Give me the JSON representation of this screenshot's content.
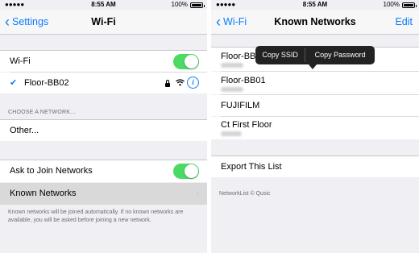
{
  "status_bar": {
    "time": "8:55 AM",
    "battery": "100%"
  },
  "left": {
    "nav": {
      "back_label": "Settings",
      "title": "Wi-Fi"
    },
    "wifi_row": {
      "label": "Wi-Fi",
      "on": true
    },
    "connected_network": {
      "name": "Floor-BB02"
    },
    "choose_header": "CHOOSE A NETWORK...",
    "other_label": "Other...",
    "ask_to_join": {
      "label": "Ask to Join Networks",
      "on": true
    },
    "known_networks_label": "Known Networks",
    "footer": "Known networks will be joined automatically. If no known networks are available, you will be asked before joining a new network."
  },
  "right": {
    "nav": {
      "back_label": "Wi-Fi",
      "title": "Known Networks",
      "edit_label": "Edit"
    },
    "popup": {
      "copy_ssid": "Copy SSID",
      "copy_password": "Copy Password"
    },
    "networks": [
      {
        "name": "Floor-BB"
      },
      {
        "name": "Floor-BB01"
      },
      {
        "name": "FUJIFILM"
      },
      {
        "name": "Ct First Floor"
      }
    ],
    "export_label": "Export This List",
    "footer": "NetworkList © Qusic"
  }
}
